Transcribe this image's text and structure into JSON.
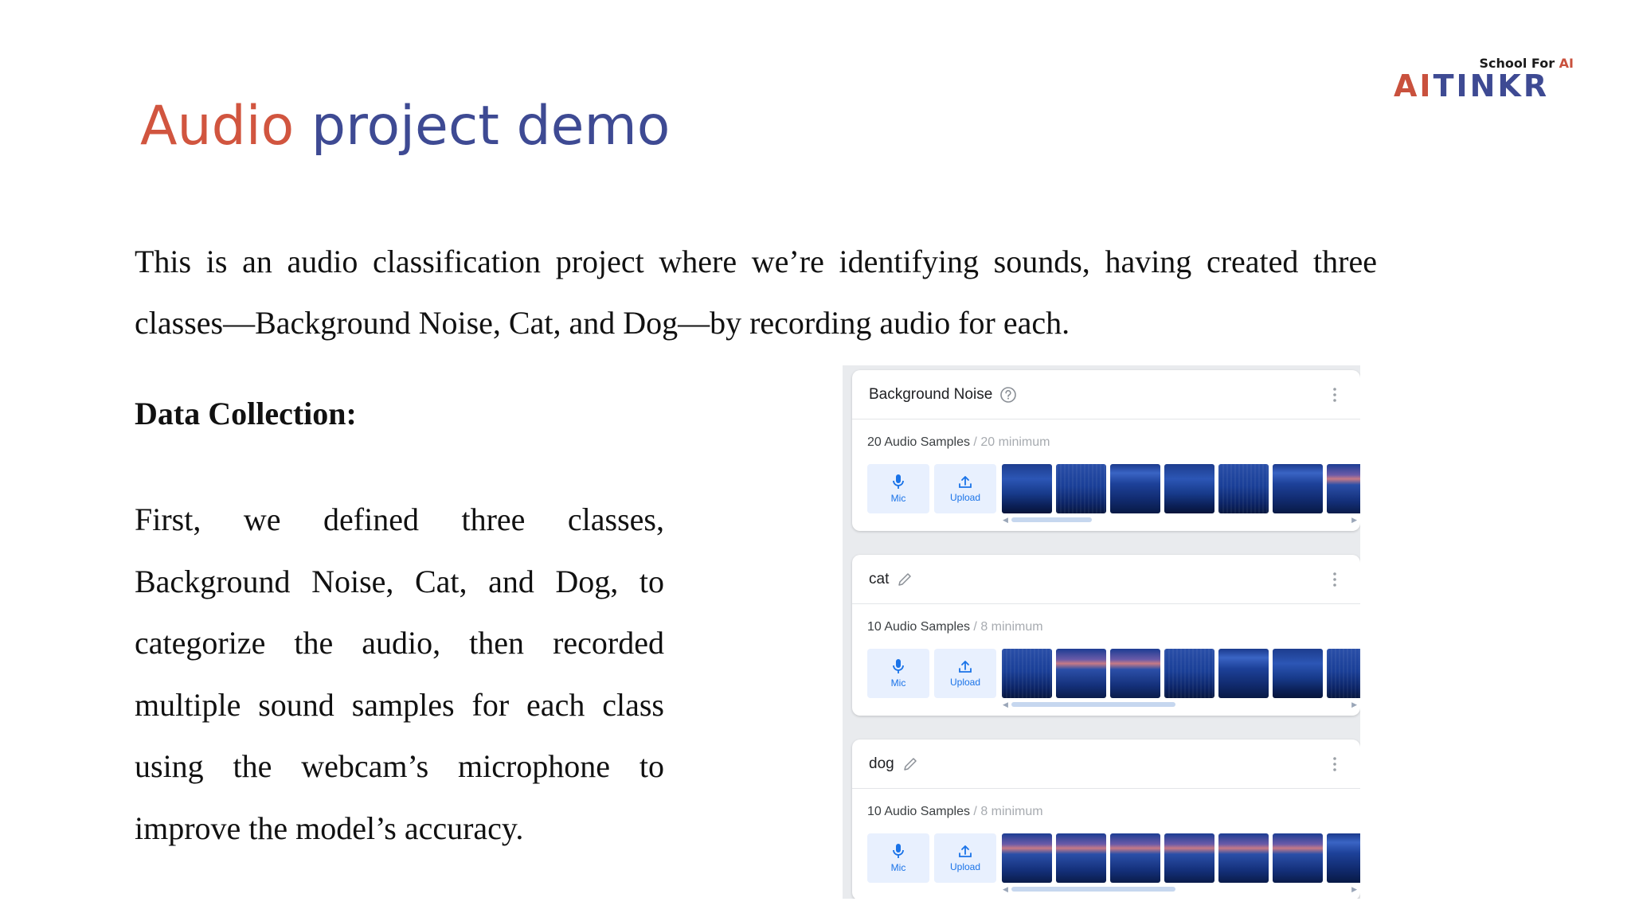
{
  "logo": {
    "tagline_prefix": "School For ",
    "tagline_ai": "AI",
    "brand_ai": "AI",
    "brand_rest": "TINKR",
    "colors": {
      "ai": "#c9513d",
      "tinkr": "#3e4a93"
    }
  },
  "title": {
    "word1": "Audio",
    "word2": " project demo",
    "colors": {
      "word1": "#d1553f",
      "word2": "#3e4a93"
    }
  },
  "intro": "This is an audio classification project where we’re identifying sounds, having created three classes—Background Noise, Cat, and Dog—by recording audio for each.",
  "section": {
    "heading": "Data Collection:",
    "body": "First, we defined three classes, Background Noise, Cat, and Dog, to categorize the audio, then recorded multiple sound samples for each class using the webcam’s microphone to improve the model’s accuracy."
  },
  "classes": [
    {
      "name": "Background Noise",
      "head_icon": "help-icon",
      "samples_label": "20 Audio Samples",
      "minimum_label": " / 20 minimum",
      "mic_label": "Mic",
      "upload_label": "Upload",
      "scroll_position": 0.24
    },
    {
      "name": "cat",
      "head_icon": "pencil-icon",
      "samples_label": "10 Audio Samples",
      "minimum_label": " / 8 minimum",
      "mic_label": "Mic",
      "upload_label": "Upload",
      "scroll_position": 0.49
    },
    {
      "name": "dog",
      "head_icon": "pencil-icon",
      "samples_label": "10 Audio Samples",
      "minimum_label": " / 8 minimum",
      "mic_label": "Mic",
      "upload_label": "Upload",
      "scroll_position": 0.49
    }
  ],
  "accent_color": "#1a73e8"
}
